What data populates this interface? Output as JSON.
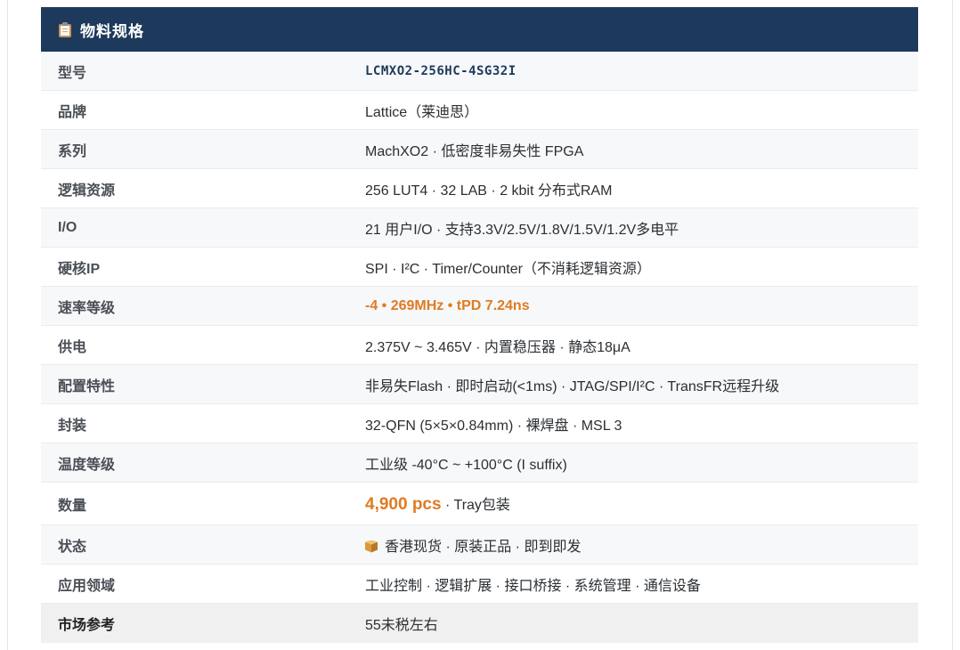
{
  "header": {
    "title": "物料规格",
    "icon": "clipboard-icon"
  },
  "colors": {
    "header_bg": "#1d3a5c",
    "accent": "#e07b22"
  },
  "rows": [
    {
      "label": "型号",
      "value": "LCMXO2-256HC-4SG32I"
    },
    {
      "label": "品牌",
      "value": "Lattice（莱迪思）"
    },
    {
      "label": "系列",
      "value": "MachXO2 · 低密度非易失性 FPGA"
    },
    {
      "label": "逻辑资源",
      "value": "256 LUT4 · 32 LAB · 2 kbit 分布式RAM"
    },
    {
      "label": "I/O",
      "value": "21 用户I/O · 支持3.3V/2.5V/1.8V/1.5V/1.2V多电平"
    },
    {
      "label": "硬核IP",
      "value": "SPI · I²C · Timer/Counter（不消耗逻辑资源）"
    },
    {
      "label": "速率等级",
      "value": "-4 • 269MHz • tPD 7.24ns"
    },
    {
      "label": "供电",
      "value": "2.375V ~ 3.465V · 内置稳压器 · 静态18μA"
    },
    {
      "label": "配置特性",
      "value": "非易失Flash · 即时启动(<1ms) · JTAG/SPI/I²C · TransFR远程升级"
    },
    {
      "label": "封装",
      "value": "32-QFN (5×5×0.84mm) · 裸焊盘 · MSL 3"
    },
    {
      "label": "温度等级",
      "value": "工业级 -40°C ~ +100°C (I suffix)"
    },
    {
      "label": "数量",
      "value_highlight": "4,900 pcs",
      "value_rest": " · Tray包装"
    },
    {
      "label": "状态",
      "value": "香港现货 · 原装正品 · 即到即发",
      "icon": "package-icon"
    },
    {
      "label": "应用领域",
      "value": "工业控制 · 逻辑扩展 · 接口桥接 · 系统管理 · 通信设备"
    },
    {
      "label": "市场参考",
      "value": "55未税左右"
    }
  ]
}
